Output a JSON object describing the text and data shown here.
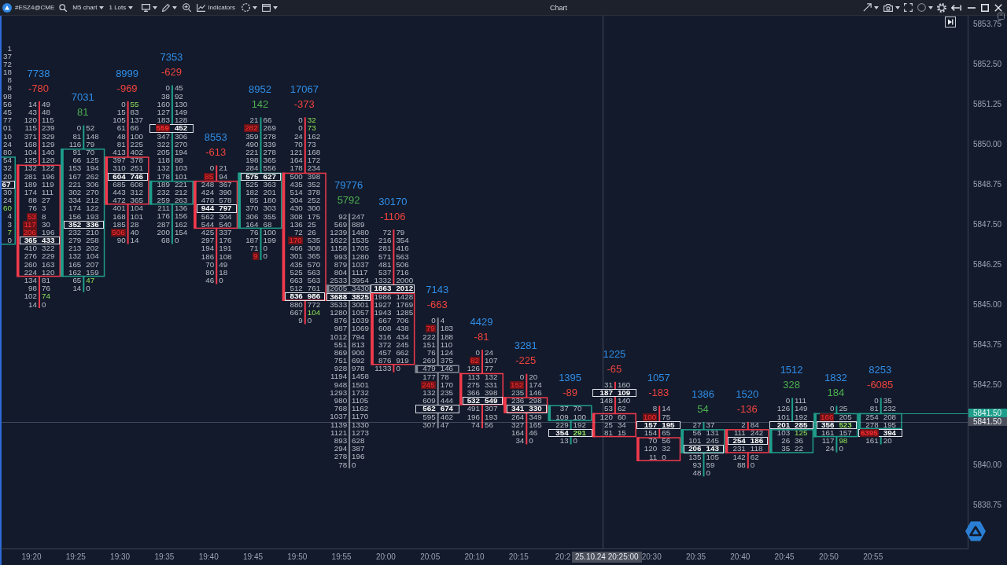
{
  "toolbar": {
    "symbol": "#ESZ4@CME",
    "timeframe": "M5 chart",
    "lots": "1 Lots",
    "indicators": "Indicators",
    "title": "Chart"
  },
  "chart": {
    "partial_bar": {
      "kind": "up",
      "upper": [
        {
          "ask": "1",
          "kind": "plain"
        },
        {
          "ask": "37",
          "kind": "plain"
        },
        {
          "ask": "72",
          "kind": "plain"
        },
        {
          "ask": "18",
          "kind": "plain"
        },
        {
          "ask": "8",
          "kind": "plain"
        },
        {
          "ask": "8",
          "kind": "plain"
        },
        {
          "ask": "98",
          "kind": "plain"
        },
        {
          "ask": "56",
          "kind": "plain"
        },
        {
          "ask": "45",
          "kind": "plain"
        },
        {
          "ask": "77",
          "kind": "plain"
        },
        {
          "ask": "01",
          "kind": "plain"
        },
        {
          "ask": "10",
          "kind": "plain"
        },
        {
          "ask": "24",
          "kind": "plain"
        },
        {
          "ask": "80",
          "kind": "plain"
        }
      ],
      "body": [
        {
          "ask": "54",
          "kind": "plain"
        },
        {
          "ask": "32",
          "kind": "plain"
        },
        {
          "ask": "20",
          "kind": "plain"
        },
        {
          "ask": "67",
          "kind": "poc"
        },
        {
          "ask": "30",
          "kind": "plain"
        },
        {
          "ask": "24",
          "kind": "plain"
        },
        {
          "ask": "60",
          "kind": "ask_imbalance"
        },
        {
          "ask": "4",
          "kind": "plain"
        },
        {
          "ask": "3",
          "kind": "plain"
        },
        {
          "ask": "7",
          "kind": "ask_imbalance"
        },
        {
          "ask": "0",
          "kind": "plain"
        }
      ]
    },
    "bars": [
      {
        "time": "19:20",
        "volume": "7738",
        "delta": "-780",
        "delta_positive": false,
        "kind": "down",
        "upper": [
          {
            "bid": "14",
            "ask": "49",
            "kind": "plain"
          },
          {
            "bid": "43",
            "ask": "48",
            "kind": "plain"
          },
          {
            "bid": "120",
            "ask": "115",
            "kind": "plain"
          },
          {
            "bid": "115",
            "ask": "239",
            "kind": "plain"
          },
          {
            "bid": "371",
            "ask": "329",
            "kind": "plain"
          },
          {
            "bid": "168",
            "ask": "129",
            "kind": "plain"
          },
          {
            "bid": "104",
            "ask": "140",
            "kind": "plain"
          },
          {
            "bid": "125",
            "ask": "120",
            "kind": "plain"
          }
        ],
        "body": [
          {
            "bid": "132",
            "ask": "122",
            "kind": "plain"
          },
          {
            "bid": "281",
            "ask": "196",
            "kind": "plain"
          },
          {
            "bid": "189",
            "ask": "119",
            "kind": "plain"
          },
          {
            "bid": "174",
            "ask": "111",
            "kind": "plain"
          },
          {
            "bid": "88",
            "ask": "27",
            "kind": "plain"
          },
          {
            "bid": "76",
            "ask": "3",
            "kind": "plain"
          },
          {
            "bid": "53",
            "ask": "8",
            "kind": "bid_imbalance"
          },
          {
            "bid": "117",
            "ask": "30",
            "kind": "bid_imbalance"
          },
          {
            "bid": "206",
            "ask": "196",
            "kind": "bid_imbalance"
          },
          {
            "bid": "365",
            "ask": "433",
            "kind": "poc"
          },
          {
            "bid": "410",
            "ask": "322",
            "kind": "plain"
          },
          {
            "bid": "276",
            "ask": "229",
            "kind": "plain"
          },
          {
            "bid": "260",
            "ask": "163",
            "kind": "plain"
          },
          {
            "bid": "224",
            "ask": "120",
            "kind": "plain"
          }
        ],
        "lower": [
          {
            "bid": "134",
            "ask": "81",
            "kind": "plain"
          },
          {
            "bid": "98",
            "ask": "76",
            "kind": "plain"
          },
          {
            "bid": "102",
            "ask": "74",
            "kind": "ask_imbalance"
          },
          {
            "bid": "14",
            "ask": "0",
            "kind": "plain"
          }
        ]
      },
      {
        "time": "19:25",
        "volume": "7031",
        "delta": "81",
        "delta_positive": true,
        "kind": "up",
        "upper": [
          {
            "bid": "0",
            "ask": "52",
            "kind": "plain"
          },
          {
            "bid": "81",
            "ask": "148",
            "kind": "plain"
          },
          {
            "bid": "116",
            "ask": "79",
            "kind": "plain"
          }
        ],
        "body": [
          {
            "bid": "91",
            "ask": "70",
            "kind": "plain"
          },
          {
            "bid": "66",
            "ask": "125",
            "kind": "plain"
          },
          {
            "bid": "153",
            "ask": "194",
            "kind": "plain"
          },
          {
            "bid": "167",
            "ask": "262",
            "kind": "plain"
          },
          {
            "bid": "221",
            "ask": "306",
            "kind": "plain"
          },
          {
            "bid": "302",
            "ask": "270",
            "kind": "plain"
          },
          {
            "bid": "334",
            "ask": "212",
            "kind": "plain"
          },
          {
            "bid": "174",
            "ask": "122",
            "kind": "plain"
          },
          {
            "bid": "156",
            "ask": "193",
            "kind": "plain"
          },
          {
            "bid": "352",
            "ask": "336",
            "kind": "poc"
          },
          {
            "bid": "232",
            "ask": "210",
            "kind": "plain"
          },
          {
            "bid": "279",
            "ask": "258",
            "kind": "plain"
          },
          {
            "bid": "213",
            "ask": "202",
            "kind": "plain"
          },
          {
            "bid": "132",
            "ask": "104",
            "kind": "plain"
          },
          {
            "bid": "165",
            "ask": "207",
            "kind": "plain"
          },
          {
            "bid": "162",
            "ask": "159",
            "kind": "plain"
          }
        ],
        "lower": [
          {
            "bid": "65",
            "ask": "47",
            "kind": "ask_imbalance"
          },
          {
            "bid": "14",
            "ask": "0",
            "kind": "plain"
          }
        ]
      },
      {
        "time": "19:30",
        "volume": "8999",
        "delta": "-969",
        "delta_positive": false,
        "kind": "down",
        "upper": [
          {
            "bid": "0",
            "ask": "55",
            "kind": "ask_imbalance"
          },
          {
            "bid": "15",
            "ask": "83",
            "kind": "plain"
          },
          {
            "bid": "105",
            "ask": "137",
            "kind": "plain"
          },
          {
            "bid": "61",
            "ask": "66",
            "kind": "plain"
          },
          {
            "bid": "48",
            "ask": "100",
            "kind": "plain"
          },
          {
            "bid": "81",
            "ask": "225",
            "kind": "plain"
          },
          {
            "bid": "413",
            "ask": "402",
            "kind": "plain"
          }
        ],
        "body": [
          {
            "bid": "397",
            "ask": "378",
            "kind": "plain"
          },
          {
            "bid": "310",
            "ask": "251",
            "kind": "plain"
          },
          {
            "bid": "604",
            "ask": "746",
            "kind": "poc"
          },
          {
            "bid": "685",
            "ask": "608",
            "kind": "plain"
          },
          {
            "bid": "443",
            "ask": "312",
            "kind": "plain"
          },
          {
            "bid": "472",
            "ask": "365",
            "kind": "plain"
          }
        ],
        "lower": [
          {
            "bid": "401",
            "ask": "104",
            "kind": "plain"
          },
          {
            "bid": "168",
            "ask": "101",
            "kind": "plain"
          },
          {
            "bid": "185",
            "ask": "28",
            "kind": "plain"
          },
          {
            "bid": "506",
            "ask": "40",
            "kind": "bid_imbalance"
          },
          {
            "bid": "90",
            "ask": "14",
            "kind": "plain"
          }
        ]
      },
      {
        "time": "19:35",
        "volume": "7353",
        "delta": "-629",
        "delta_positive": false,
        "kind": "up",
        "upper": [
          {
            "bid": "0",
            "ask": "45",
            "kind": "plain"
          },
          {
            "bid": "38",
            "ask": "92",
            "kind": "plain"
          },
          {
            "bid": "160",
            "ask": "130",
            "kind": "plain"
          },
          {
            "bid": "127",
            "ask": "149",
            "kind": "plain"
          },
          {
            "bid": "183",
            "ask": "128",
            "kind": "plain"
          },
          {
            "bid": "559",
            "ask": "452",
            "kind": "poc_bid_imbalance"
          },
          {
            "bid": "347",
            "ask": "306",
            "kind": "plain"
          },
          {
            "bid": "322",
            "ask": "270",
            "kind": "plain"
          },
          {
            "bid": "205",
            "ask": "194",
            "kind": "plain"
          },
          {
            "bid": "118",
            "ask": "88",
            "kind": "plain"
          },
          {
            "bid": "132",
            "ask": "103",
            "kind": "plain"
          },
          {
            "bid": "178",
            "ask": "101",
            "kind": "plain"
          }
        ],
        "body": [
          {
            "bid": "189",
            "ask": "221",
            "kind": "plain"
          },
          {
            "bid": "232",
            "ask": "212",
            "kind": "plain"
          },
          {
            "bid": "259",
            "ask": "263",
            "kind": "plain"
          }
        ],
        "lower": [
          {
            "bid": "211",
            "ask": "136",
            "kind": "plain"
          },
          {
            "bid": "176",
            "ask": "156",
            "kind": "plain"
          },
          {
            "bid": "287",
            "ask": "162",
            "kind": "plain"
          },
          {
            "bid": "200",
            "ask": "154",
            "kind": "plain"
          },
          {
            "bid": "68",
            "ask": "0",
            "kind": "plain"
          }
        ]
      },
      {
        "time": "19:40",
        "volume": "8553",
        "delta": "-613",
        "delta_positive": false,
        "kind": "down",
        "upper": [
          {
            "bid": "0",
            "ask": "21",
            "kind": "plain"
          },
          {
            "bid": "85",
            "ask": "94",
            "kind": "bid_imbalance"
          }
        ],
        "body": [
          {
            "bid": "248",
            "ask": "367",
            "kind": "plain"
          },
          {
            "bid": "424",
            "ask": "390",
            "kind": "plain"
          },
          {
            "bid": "478",
            "ask": "578",
            "kind": "plain"
          },
          {
            "bid": "944",
            "ask": "797",
            "kind": "poc"
          },
          {
            "bid": "562",
            "ask": "304",
            "kind": "plain"
          },
          {
            "bid": "544",
            "ask": "540",
            "kind": "plain"
          }
        ],
        "lower": [
          {
            "bid": "425",
            "ask": "337",
            "kind": "plain"
          },
          {
            "bid": "297",
            "ask": "176",
            "kind": "plain"
          },
          {
            "bid": "194",
            "ask": "191",
            "kind": "plain"
          },
          {
            "bid": "186",
            "ask": "108",
            "kind": "plain"
          },
          {
            "bid": "70",
            "ask": "49",
            "kind": "plain"
          },
          {
            "bid": "80",
            "ask": "18",
            "kind": "plain"
          },
          {
            "bid": "46",
            "ask": "0",
            "kind": "plain"
          }
        ]
      },
      {
        "time": "19:45",
        "volume": "8952",
        "delta": "142",
        "delta_positive": true,
        "kind": "up",
        "upper": [
          {
            "bid": "21",
            "ask": "66",
            "kind": "plain"
          },
          {
            "bid": "282",
            "ask": "269",
            "kind": "bid_imbalance"
          },
          {
            "bid": "359",
            "ask": "278",
            "kind": "plain"
          },
          {
            "bid": "490",
            "ask": "339",
            "kind": "plain"
          },
          {
            "bid": "221",
            "ask": "278",
            "kind": "plain"
          },
          {
            "bid": "198",
            "ask": "365",
            "kind": "plain"
          },
          {
            "bid": "284",
            "ask": "556",
            "kind": "plain"
          }
        ],
        "body": [
          {
            "bid": "575",
            "ask": "627",
            "kind": "poc"
          },
          {
            "bid": "525",
            "ask": "363",
            "kind": "plain"
          },
          {
            "bid": "182",
            "ask": "201",
            "kind": "plain"
          },
          {
            "bid": "85",
            "ask": "180",
            "kind": "plain"
          },
          {
            "bid": "370",
            "ask": "303",
            "kind": "plain"
          },
          {
            "bid": "306",
            "ask": "355",
            "kind": "plain"
          },
          {
            "bid": "164",
            "ask": "68",
            "kind": "plain"
          }
        ],
        "lower": [
          {
            "bid": "76",
            "ask": "100",
            "kind": "plain"
          },
          {
            "bid": "187",
            "ask": "199",
            "kind": "plain"
          },
          {
            "bid": "71",
            "ask": "0",
            "kind": "plain"
          },
          {
            "bid": "9",
            "ask": "0",
            "kind": "bid_imbalance"
          }
        ]
      },
      {
        "time": "19:50",
        "volume": "17067",
        "delta": "-373",
        "delta_positive": false,
        "kind": "down",
        "upper": [
          {
            "bid": "0",
            "ask": "32",
            "kind": "ask_imbalance"
          },
          {
            "bid": "0",
            "ask": "73",
            "kind": "ask_imbalance"
          },
          {
            "bid": "24",
            "ask": "162",
            "kind": "plain"
          },
          {
            "bid": "70",
            "ask": "73",
            "kind": "plain"
          },
          {
            "bid": "121",
            "ask": "168",
            "kind": "plain"
          },
          {
            "bid": "164",
            "ask": "172",
            "kind": "plain"
          },
          {
            "bid": "178",
            "ask": "234",
            "kind": "plain"
          }
        ],
        "body": [
          {
            "bid": "500",
            "ask": "398",
            "kind": "plain"
          },
          {
            "bid": "435",
            "ask": "352",
            "kind": "plain"
          },
          {
            "bid": "514",
            "ask": "378",
            "kind": "plain"
          },
          {
            "bid": "304",
            "ask": "252",
            "kind": "plain"
          },
          {
            "bid": "430",
            "ask": "300",
            "kind": "plain"
          },
          {
            "bid": "308",
            "ask": "175",
            "kind": "plain"
          },
          {
            "bid": "136",
            "ask": "25",
            "kind": "plain"
          },
          {
            "bid": "72",
            "ask": "26",
            "kind": "plain"
          },
          {
            "bid": "170",
            "ask": "535",
            "kind": "bid_imbalance"
          },
          {
            "bid": "466",
            "ask": "308",
            "kind": "plain"
          },
          {
            "bid": "301",
            "ask": "365",
            "kind": "plain"
          },
          {
            "bid": "435",
            "ask": "570",
            "kind": "plain"
          },
          {
            "bid": "525",
            "ask": "563",
            "kind": "plain"
          },
          {
            "bid": "663",
            "ask": "563",
            "kind": "plain"
          },
          {
            "bid": "512",
            "ask": "761",
            "kind": "plain"
          },
          {
            "bid": "836",
            "ask": "986",
            "kind": "poc"
          }
        ],
        "lower": [
          {
            "bid": "880",
            "ask": "772",
            "kind": "plain"
          },
          {
            "bid": "667",
            "ask": "104",
            "kind": "ask_imbalance"
          },
          {
            "bid": "9",
            "ask": "0",
            "kind": "plain"
          }
        ]
      },
      {
        "time": "19:55",
        "volume": "79776",
        "delta": "5792",
        "delta_positive": true,
        "kind": "flat",
        "upper": [
          {
            "bid": "92",
            "ask": "247",
            "kind": "plain"
          },
          {
            "bid": "569",
            "ask": "889",
            "kind": "plain"
          },
          {
            "bid": "1239",
            "ask": "1480",
            "kind": "plain"
          },
          {
            "bid": "1622",
            "ask": "1535",
            "kind": "plain"
          },
          {
            "bid": "1158",
            "ask": "1705",
            "kind": "plain"
          },
          {
            "bid": "993",
            "ask": "1280",
            "kind": "plain"
          },
          {
            "bid": "879",
            "ask": "1037",
            "kind": "plain"
          },
          {
            "bid": "804",
            "ask": "1117",
            "kind": "plain"
          },
          {
            "bid": "2533",
            "ask": "3954",
            "kind": "plain"
          }
        ],
        "body": [
          {
            "bid": "2605",
            "ask": "3430",
            "kind": "plain"
          }
        ],
        "lower": [
          {
            "bid": "3688",
            "ask": "3825",
            "kind": "poc"
          },
          {
            "bid": "3533",
            "ask": "3001",
            "kind": "plain"
          },
          {
            "bid": "1280",
            "ask": "1057",
            "kind": "plain"
          },
          {
            "bid": "876",
            "ask": "1039",
            "kind": "plain"
          },
          {
            "bid": "987",
            "ask": "1069",
            "kind": "plain"
          },
          {
            "bid": "1012",
            "ask": "794",
            "kind": "plain"
          },
          {
            "bid": "551",
            "ask": "813",
            "kind": "plain"
          },
          {
            "bid": "869",
            "ask": "900",
            "kind": "plain"
          },
          {
            "bid": "751",
            "ask": "692",
            "kind": "plain"
          },
          {
            "bid": "928",
            "ask": "978",
            "kind": "plain"
          },
          {
            "bid": "1194",
            "ask": "1458",
            "kind": "plain"
          },
          {
            "bid": "948",
            "ask": "1501",
            "kind": "plain"
          },
          {
            "bid": "1293",
            "ask": "1732",
            "kind": "plain"
          },
          {
            "bid": "980",
            "ask": "1105",
            "kind": "plain"
          },
          {
            "bid": "768",
            "ask": "1162",
            "kind": "plain"
          },
          {
            "bid": "1037",
            "ask": "1170",
            "kind": "plain"
          },
          {
            "bid": "1139",
            "ask": "1330",
            "kind": "plain"
          },
          {
            "bid": "1121",
            "ask": "1273",
            "kind": "plain"
          },
          {
            "bid": "893",
            "ask": "628",
            "kind": "plain"
          },
          {
            "bid": "294",
            "ask": "387",
            "kind": "plain"
          },
          {
            "bid": "278",
            "ask": "196",
            "kind": "plain"
          },
          {
            "bid": "78",
            "ask": "0",
            "kind": "plain"
          }
        ]
      },
      {
        "time": "20:00",
        "volume": "30170",
        "delta": "-1106",
        "delta_positive": false,
        "kind": "down",
        "upper": [
          {
            "bid": "72",
            "ask": "79",
            "kind": "plain"
          },
          {
            "bid": "216",
            "ask": "354",
            "kind": "plain"
          },
          {
            "bid": "281",
            "ask": "416",
            "kind": "plain"
          },
          {
            "bid": "571",
            "ask": "563",
            "kind": "plain"
          },
          {
            "bid": "481",
            "ask": "506",
            "kind": "plain"
          },
          {
            "bid": "537",
            "ask": "716",
            "kind": "plain"
          },
          {
            "bid": "1332",
            "ask": "2000",
            "kind": "plain"
          },
          {
            "bid": "1863",
            "ask": "2012",
            "kind": "poc"
          }
        ],
        "body": [
          {
            "bid": "1986",
            "ask": "1428",
            "kind": "plain"
          },
          {
            "bid": "1927",
            "ask": "1769",
            "kind": "plain"
          },
          {
            "bid": "1943",
            "ask": "1285",
            "kind": "plain"
          },
          {
            "bid": "667",
            "ask": "706",
            "kind": "plain"
          },
          {
            "bid": "608",
            "ask": "438",
            "kind": "plain"
          },
          {
            "bid": "316",
            "ask": "434",
            "kind": "plain"
          },
          {
            "bid": "372",
            "ask": "245",
            "kind": "plain"
          },
          {
            "bid": "457",
            "ask": "662",
            "kind": "plain"
          },
          {
            "bid": "876",
            "ask": "919",
            "kind": "plain"
          }
        ],
        "lower": [
          {
            "bid": "1133",
            "ask": "0",
            "kind": "plain"
          }
        ]
      },
      {
        "time": "20:05",
        "volume": "7143",
        "delta": "-663",
        "delta_positive": false,
        "kind": "flat",
        "upper": [
          {
            "bid": "0",
            "ask": "4",
            "kind": "plain"
          },
          {
            "bid": "79",
            "ask": "183",
            "kind": "bid_imbalance"
          },
          {
            "bid": "222",
            "ask": "188",
            "kind": "plain"
          },
          {
            "bid": "151",
            "ask": "110",
            "kind": "plain"
          },
          {
            "bid": "76",
            "ask": "124",
            "kind": "plain"
          },
          {
            "bid": "269",
            "ask": "375",
            "kind": "plain"
          }
        ],
        "body": [
          {
            "bid": "479",
            "ask": "146",
            "kind": "plain"
          }
        ],
        "lower": [
          {
            "bid": "177",
            "ask": "78",
            "kind": "plain"
          },
          {
            "bid": "245",
            "ask": "170",
            "kind": "bid_imbalance"
          },
          {
            "bid": "132",
            "ask": "235",
            "kind": "plain"
          },
          {
            "bid": "609",
            "ask": "444",
            "kind": "plain"
          },
          {
            "bid": "562",
            "ask": "674",
            "kind": "poc"
          },
          {
            "bid": "595",
            "ask": "462",
            "kind": "plain"
          },
          {
            "bid": "307",
            "ask": "47",
            "kind": "plain"
          }
        ]
      },
      {
        "time": "20:10",
        "volume": "4429",
        "delta": "-81",
        "delta_positive": false,
        "kind": "down",
        "upper": [
          {
            "bid": "0",
            "ask": "24",
            "kind": "plain"
          },
          {
            "bid": "82",
            "ask": "107",
            "kind": "bid_imbalance"
          },
          {
            "bid": "126",
            "ask": "77",
            "kind": "plain"
          }
        ],
        "body": [
          {
            "bid": "113",
            "ask": "132",
            "kind": "plain"
          },
          {
            "bid": "275",
            "ask": "331",
            "kind": "plain"
          },
          {
            "bid": "366",
            "ask": "398",
            "kind": "plain"
          },
          {
            "bid": "532",
            "ask": "549",
            "kind": "poc"
          }
        ],
        "lower": [
          {
            "bid": "491",
            "ask": "307",
            "kind": "plain"
          },
          {
            "bid": "196",
            "ask": "193",
            "kind": "plain"
          },
          {
            "bid": "74",
            "ask": "56",
            "kind": "plain"
          }
        ]
      },
      {
        "time": "20:15",
        "volume": "3281",
        "delta": "-225",
        "delta_positive": false,
        "kind": "down",
        "upper": [
          {
            "bid": "0",
            "ask": "20",
            "kind": "plain"
          },
          {
            "bid": "152",
            "ask": "174",
            "kind": "bid_imbalance"
          },
          {
            "bid": "235",
            "ask": "146",
            "kind": "plain"
          }
        ],
        "body": [
          {
            "bid": "236",
            "ask": "298",
            "kind": "plain"
          },
          {
            "bid": "341",
            "ask": "330",
            "kind": "poc"
          }
        ],
        "lower": [
          {
            "bid": "264",
            "ask": "349",
            "kind": "plain"
          },
          {
            "bid": "327",
            "ask": "165",
            "kind": "plain"
          },
          {
            "bid": "164",
            "ask": "46",
            "kind": "plain"
          },
          {
            "bid": "34",
            "ask": "0",
            "kind": "plain"
          }
        ]
      },
      {
        "time": "20:2",
        "volume": "1395",
        "delta": "-89",
        "delta_positive": false,
        "kind": "up",
        "body": [
          {
            "bid": "37",
            "ask": "70",
            "kind": "plain"
          },
          {
            "bid": "109",
            "ask": "100",
            "kind": "plain"
          }
        ],
        "lower": [
          {
            "bid": "229",
            "ask": "192",
            "kind": "plain"
          },
          {
            "bid": "354",
            "ask": "291",
            "kind": "poc_ask_imbalance"
          },
          {
            "bid": "13",
            "ask": "0",
            "kind": "plain"
          }
        ]
      },
      {
        "volume": "1225",
        "delta": "-65",
        "delta_positive": false,
        "kind": "down",
        "upper": [
          {
            "bid": "31",
            "ask": "160",
            "kind": "plain"
          },
          {
            "bid": "187",
            "ask": "109",
            "kind": "poc"
          },
          {
            "bid": "148",
            "ask": "140",
            "kind": "plain"
          },
          {
            "bid": "53",
            "ask": "62",
            "kind": "plain"
          }
        ],
        "body": [
          {
            "bid": "120",
            "ask": "60",
            "kind": "plain"
          },
          {
            "bid": "25",
            "ask": "34",
            "kind": "plain"
          },
          {
            "bid": "81",
            "ask": "15",
            "kind": "plain"
          }
        ]
      },
      {
        "time": "20:30",
        "volume": "1057",
        "delta": "-183",
        "delta_positive": false,
        "kind": "down",
        "upper": [
          {
            "bid": "8",
            "ask": "14",
            "kind": "plain"
          },
          {
            "bid": "100",
            "ask": "75",
            "kind": "bid_imbalance"
          },
          {
            "bid": "157",
            "ask": "195",
            "kind": "poc"
          },
          {
            "bid": "154",
            "ask": "65",
            "kind": "plain"
          }
        ],
        "body": [
          {
            "bid": "70",
            "ask": "56",
            "kind": "plain"
          },
          {
            "bid": "120",
            "ask": "32",
            "kind": "plain"
          },
          {
            "bid": "11",
            "ask": "0",
            "kind": "plain"
          }
        ]
      },
      {
        "time": "20:35",
        "volume": "1386",
        "delta": "54",
        "delta_positive": true,
        "kind": "up",
        "upper": [
          {
            "bid": "27",
            "ask": "37",
            "kind": "plain"
          }
        ],
        "body": [
          {
            "bid": "56",
            "ask": "131",
            "kind": "plain"
          },
          {
            "bid": "101",
            "ask": "245",
            "kind": "plain"
          },
          {
            "bid": "206",
            "ask": "143",
            "kind": "poc"
          }
        ],
        "lower": [
          {
            "bid": "135",
            "ask": "105",
            "kind": "plain"
          },
          {
            "bid": "93",
            "ask": "59",
            "kind": "plain"
          },
          {
            "bid": "48",
            "ask": "0",
            "kind": "plain"
          }
        ]
      },
      {
        "time": "20:40",
        "volume": "1520",
        "delta": "-136",
        "delta_positive": false,
        "kind": "down",
        "upper": [
          {
            "bid": "2",
            "ask": "84",
            "kind": "plain"
          }
        ],
        "body": [
          {
            "bid": "111",
            "ask": "242",
            "kind": "plain"
          },
          {
            "bid": "254",
            "ask": "186",
            "kind": "poc"
          },
          {
            "bid": "231",
            "ask": "118",
            "kind": "plain"
          }
        ],
        "lower": [
          {
            "bid": "142",
            "ask": "62",
            "kind": "plain"
          },
          {
            "bid": "88",
            "ask": "0",
            "kind": "plain"
          }
        ]
      },
      {
        "time": "20:45",
        "volume": "1512",
        "delta": "328",
        "delta_positive": true,
        "kind": "up",
        "upper": [
          {
            "bid": "0",
            "ask": "111",
            "kind": "plain"
          },
          {
            "bid": "126",
            "ask": "149",
            "kind": "plain"
          },
          {
            "bid": "101",
            "ask": "192",
            "kind": "plain"
          },
          {
            "bid": "201",
            "ask": "285",
            "kind": "poc"
          }
        ],
        "body": [
          {
            "bid": "103",
            "ask": "125",
            "kind": "ask_imbalance"
          },
          {
            "bid": "26",
            "ask": "36",
            "kind": "plain"
          },
          {
            "bid": "35",
            "ask": "22",
            "kind": "plain"
          }
        ]
      },
      {
        "time": "20:50",
        "volume": "1832",
        "delta": "184",
        "delta_positive": true,
        "kind": "up",
        "upper": [
          {
            "bid": "0",
            "ask": "25",
            "kind": "plain"
          }
        ],
        "body": [
          {
            "bid": "166",
            "ask": "205",
            "kind": "bid_imbalance"
          },
          {
            "bid": "356",
            "ask": "523",
            "kind": "poc_ask_imbalance"
          },
          {
            "bid": "161",
            "ask": "157",
            "kind": "plain"
          }
        ],
        "lower": [
          {
            "bid": "117",
            "ask": "98",
            "kind": "ask_imbalance"
          },
          {
            "bid": "24",
            "ask": "0",
            "kind": "plain"
          }
        ]
      },
      {
        "time": "20:55",
        "volume": "8253",
        "delta": "-6085",
        "delta_positive": false,
        "kind": "up",
        "upper": [
          {
            "bid": "0",
            "ask": "35",
            "kind": "plain"
          },
          {
            "bid": "81",
            "ask": "232",
            "kind": "plain"
          }
        ],
        "body": [
          {
            "bid": "254",
            "ask": "208",
            "kind": "plain"
          },
          {
            "bid": "278",
            "ask": "195",
            "kind": "plain"
          }
        ],
        "lower": [
          {
            "bid": "6395",
            "ask": "394",
            "kind": "poc_bid_imbalance"
          },
          {
            "bid": "161",
            "ask": "20",
            "kind": "plain"
          }
        ]
      }
    ],
    "price_axis": [
      "5853.75",
      "5852.50",
      "5851.25",
      "5850.00",
      "5848.75",
      "5847.50",
      "5846.25",
      "5845.00",
      "5843.75",
      "5842.50",
      "5840.00",
      "5838.75"
    ],
    "last_price": "5841.50",
    "crosshair": {
      "price_label": "5841.50",
      "time_label": "25.10.24 20:25:00"
    }
  }
}
